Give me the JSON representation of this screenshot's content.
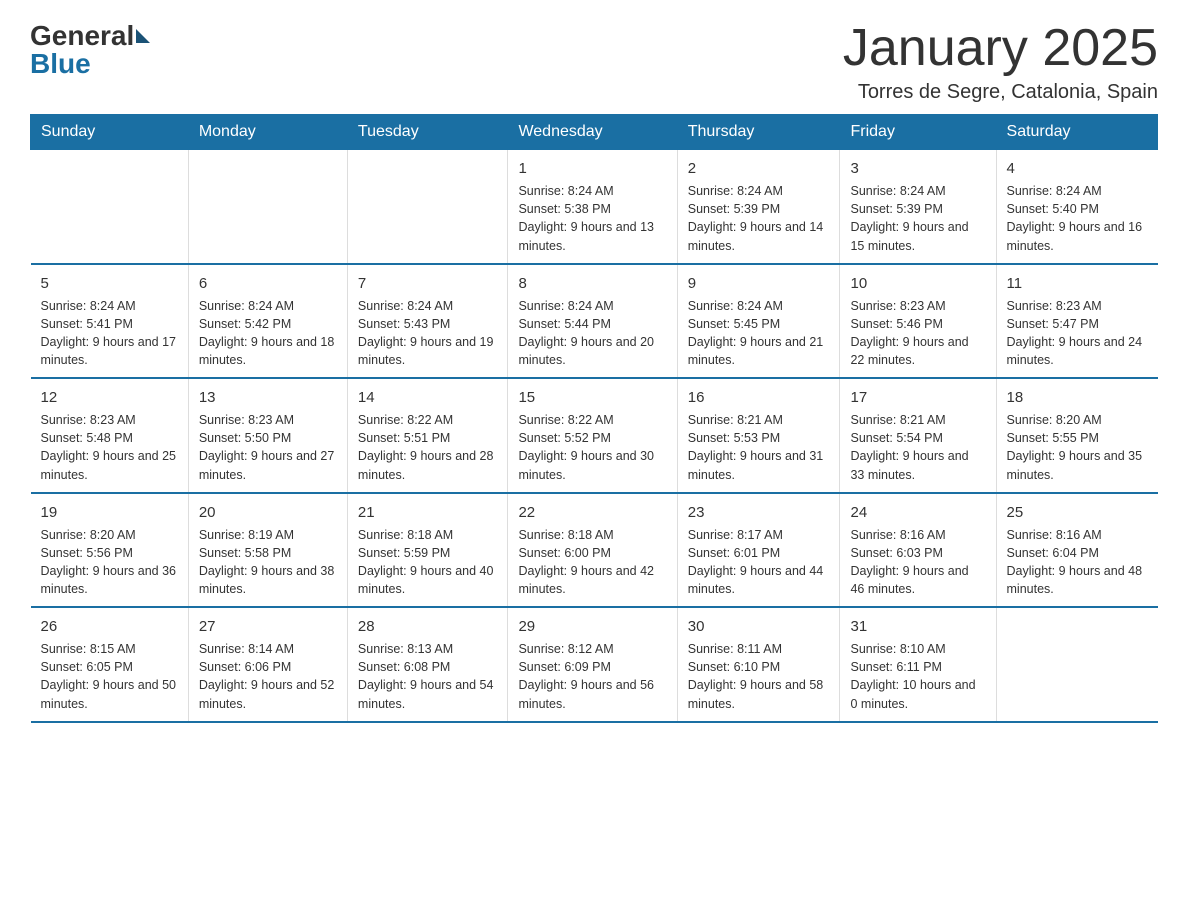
{
  "logo": {
    "general": "General",
    "blue": "Blue"
  },
  "title": "January 2025",
  "subtitle": "Torres de Segre, Catalonia, Spain",
  "days_of_week": [
    "Sunday",
    "Monday",
    "Tuesday",
    "Wednesday",
    "Thursday",
    "Friday",
    "Saturday"
  ],
  "weeks": [
    [
      {
        "day": "",
        "info": ""
      },
      {
        "day": "",
        "info": ""
      },
      {
        "day": "",
        "info": ""
      },
      {
        "day": "1",
        "info": "Sunrise: 8:24 AM\nSunset: 5:38 PM\nDaylight: 9 hours and 13 minutes."
      },
      {
        "day": "2",
        "info": "Sunrise: 8:24 AM\nSunset: 5:39 PM\nDaylight: 9 hours and 14 minutes."
      },
      {
        "day": "3",
        "info": "Sunrise: 8:24 AM\nSunset: 5:39 PM\nDaylight: 9 hours and 15 minutes."
      },
      {
        "day": "4",
        "info": "Sunrise: 8:24 AM\nSunset: 5:40 PM\nDaylight: 9 hours and 16 minutes."
      }
    ],
    [
      {
        "day": "5",
        "info": "Sunrise: 8:24 AM\nSunset: 5:41 PM\nDaylight: 9 hours and 17 minutes."
      },
      {
        "day": "6",
        "info": "Sunrise: 8:24 AM\nSunset: 5:42 PM\nDaylight: 9 hours and 18 minutes."
      },
      {
        "day": "7",
        "info": "Sunrise: 8:24 AM\nSunset: 5:43 PM\nDaylight: 9 hours and 19 minutes."
      },
      {
        "day": "8",
        "info": "Sunrise: 8:24 AM\nSunset: 5:44 PM\nDaylight: 9 hours and 20 minutes."
      },
      {
        "day": "9",
        "info": "Sunrise: 8:24 AM\nSunset: 5:45 PM\nDaylight: 9 hours and 21 minutes."
      },
      {
        "day": "10",
        "info": "Sunrise: 8:23 AM\nSunset: 5:46 PM\nDaylight: 9 hours and 22 minutes."
      },
      {
        "day": "11",
        "info": "Sunrise: 8:23 AM\nSunset: 5:47 PM\nDaylight: 9 hours and 24 minutes."
      }
    ],
    [
      {
        "day": "12",
        "info": "Sunrise: 8:23 AM\nSunset: 5:48 PM\nDaylight: 9 hours and 25 minutes."
      },
      {
        "day": "13",
        "info": "Sunrise: 8:23 AM\nSunset: 5:50 PM\nDaylight: 9 hours and 27 minutes."
      },
      {
        "day": "14",
        "info": "Sunrise: 8:22 AM\nSunset: 5:51 PM\nDaylight: 9 hours and 28 minutes."
      },
      {
        "day": "15",
        "info": "Sunrise: 8:22 AM\nSunset: 5:52 PM\nDaylight: 9 hours and 30 minutes."
      },
      {
        "day": "16",
        "info": "Sunrise: 8:21 AM\nSunset: 5:53 PM\nDaylight: 9 hours and 31 minutes."
      },
      {
        "day": "17",
        "info": "Sunrise: 8:21 AM\nSunset: 5:54 PM\nDaylight: 9 hours and 33 minutes."
      },
      {
        "day": "18",
        "info": "Sunrise: 8:20 AM\nSunset: 5:55 PM\nDaylight: 9 hours and 35 minutes."
      }
    ],
    [
      {
        "day": "19",
        "info": "Sunrise: 8:20 AM\nSunset: 5:56 PM\nDaylight: 9 hours and 36 minutes."
      },
      {
        "day": "20",
        "info": "Sunrise: 8:19 AM\nSunset: 5:58 PM\nDaylight: 9 hours and 38 minutes."
      },
      {
        "day": "21",
        "info": "Sunrise: 8:18 AM\nSunset: 5:59 PM\nDaylight: 9 hours and 40 minutes."
      },
      {
        "day": "22",
        "info": "Sunrise: 8:18 AM\nSunset: 6:00 PM\nDaylight: 9 hours and 42 minutes."
      },
      {
        "day": "23",
        "info": "Sunrise: 8:17 AM\nSunset: 6:01 PM\nDaylight: 9 hours and 44 minutes."
      },
      {
        "day": "24",
        "info": "Sunrise: 8:16 AM\nSunset: 6:03 PM\nDaylight: 9 hours and 46 minutes."
      },
      {
        "day": "25",
        "info": "Sunrise: 8:16 AM\nSunset: 6:04 PM\nDaylight: 9 hours and 48 minutes."
      }
    ],
    [
      {
        "day": "26",
        "info": "Sunrise: 8:15 AM\nSunset: 6:05 PM\nDaylight: 9 hours and 50 minutes."
      },
      {
        "day": "27",
        "info": "Sunrise: 8:14 AM\nSunset: 6:06 PM\nDaylight: 9 hours and 52 minutes."
      },
      {
        "day": "28",
        "info": "Sunrise: 8:13 AM\nSunset: 6:08 PM\nDaylight: 9 hours and 54 minutes."
      },
      {
        "day": "29",
        "info": "Sunrise: 8:12 AM\nSunset: 6:09 PM\nDaylight: 9 hours and 56 minutes."
      },
      {
        "day": "30",
        "info": "Sunrise: 8:11 AM\nSunset: 6:10 PM\nDaylight: 9 hours and 58 minutes."
      },
      {
        "day": "31",
        "info": "Sunrise: 8:10 AM\nSunset: 6:11 PM\nDaylight: 10 hours and 0 minutes."
      },
      {
        "day": "",
        "info": ""
      }
    ]
  ]
}
